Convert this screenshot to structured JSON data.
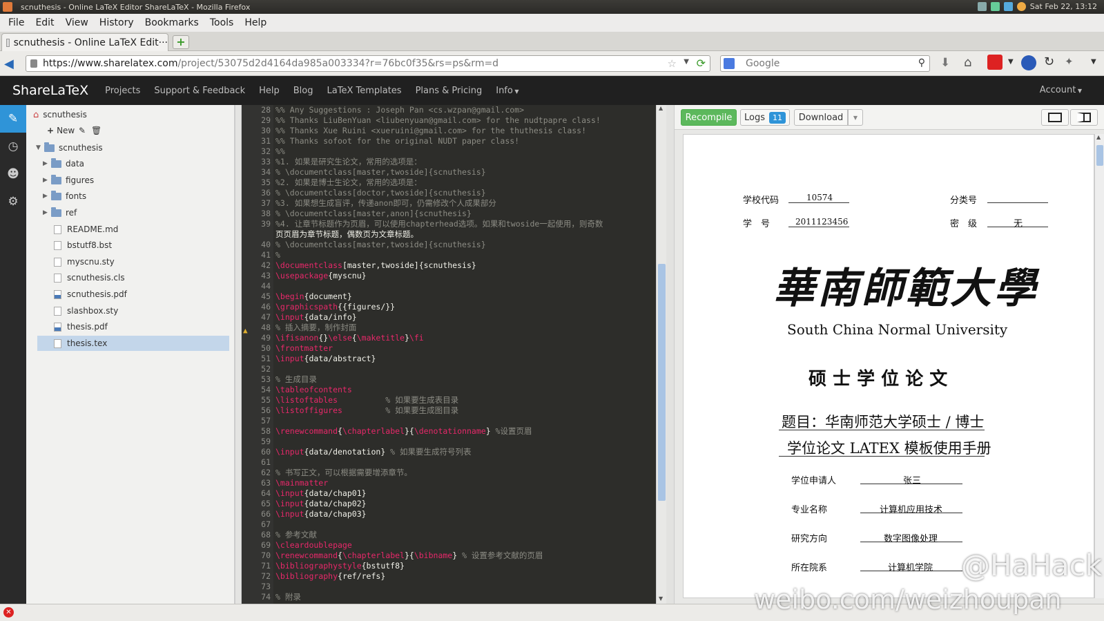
{
  "window": {
    "title": "scnuthesis - Online LaTeX Editor ShareLaTeX - Mozilla Firefox",
    "clock": "Sat Feb 22, 13:12"
  },
  "menubar": [
    "File",
    "Edit",
    "View",
    "History",
    "Bookmarks",
    "Tools",
    "Help"
  ],
  "tab": {
    "label": "scnuthesis - Online LaTeX Edit···"
  },
  "url": {
    "domain": "https://www.sharelatex.com",
    "path": "/project/53075d2d4164da985a003334?r=76bc0f35&rs=ps&rm=d"
  },
  "search": {
    "placeholder": "Google"
  },
  "app": {
    "logo": "ShareLaTeX",
    "nav": [
      "Projects",
      "Support & Feedback",
      "Help",
      "Blog",
      "LaTeX Templates",
      "Plans & Pricing",
      "Info"
    ],
    "account": "Account"
  },
  "filetree": {
    "root": "scnuthesis",
    "new_label": "New",
    "folder": "scnuthesis",
    "items": [
      {
        "name": "data",
        "type": "folder"
      },
      {
        "name": "figures",
        "type": "folder"
      },
      {
        "name": "fonts",
        "type": "folder"
      },
      {
        "name": "ref",
        "type": "folder"
      },
      {
        "name": "README.md",
        "type": "file"
      },
      {
        "name": "bstutf8.bst",
        "type": "file"
      },
      {
        "name": "myscnu.sty",
        "type": "file"
      },
      {
        "name": "scnuthesis.cls",
        "type": "file"
      },
      {
        "name": "scnuthesis.pdf",
        "type": "pdf"
      },
      {
        "name": "slashbox.sty",
        "type": "file"
      },
      {
        "name": "thesis.pdf",
        "type": "pdf"
      },
      {
        "name": "thesis.tex",
        "type": "file",
        "selected": true
      }
    ]
  },
  "editor": {
    "lines": [
      {
        "n": "28",
        "t": "%% Any Suggestions : Joseph Pan <cs.wzpan@gmail.com>"
      },
      {
        "n": "29",
        "t": "%% Thanks LiuBenYuan <liubenyuan@gmail.com> for the nudtpapre class!"
      },
      {
        "n": "30",
        "t": "%% Thanks Xue Ruini <xueruini@gmail.com> for the thuthesis class!"
      },
      {
        "n": "31",
        "t": "%% Thanks sofoot for the original NUDT paper class!"
      },
      {
        "n": "32",
        "t": "%%"
      },
      {
        "n": "33",
        "t": "%1. 如果是研究生论文，常用的选项是："
      },
      {
        "n": "34",
        "t": "% \\documentclass[master,twoside]{scnuthesis}"
      },
      {
        "n": "35",
        "t": "%2. 如果是博士生论文，常用的选项是："
      },
      {
        "n": "36",
        "t": "% \\documentclass[doctor,twoside]{scnuthesis}"
      },
      {
        "n": "37",
        "t": "%3. 如果想生成盲评，传递anon即可，仍需修改个人成果部分"
      },
      {
        "n": "38",
        "t": "% \\documentclass[master,anon]{scnuthesis}"
      },
      {
        "n": "39",
        "t": "%4. 让章节标题作为页眉，可以使用chapterhead选项。如果和twoside一起使用，则奇数"
      },
      {
        "n": "",
        "t": "页页眉为章节标题，偶数页为文章标题。"
      },
      {
        "n": "40",
        "t": "% \\documentclass[master,twoside]{scnuthesis}"
      },
      {
        "n": "41",
        "t": "%"
      },
      {
        "n": "42",
        "t": "\\documentclass[master,twoside]{scnuthesis}"
      },
      {
        "n": "43",
        "t": "\\usepackage{myscnu}"
      },
      {
        "n": "44",
        "t": ""
      },
      {
        "n": "45",
        "t": "\\begin{document}"
      },
      {
        "n": "46",
        "t": "\\graphicspath{{figures/}}"
      },
      {
        "n": "47",
        "t": "\\input{data/info}"
      },
      {
        "n": "48",
        "t": "% 插入摘要，制作封面"
      },
      {
        "n": "49",
        "t": "\\ifisanon{}\\else{\\maketitle}\\fi"
      },
      {
        "n": "50",
        "t": "\\frontmatter"
      },
      {
        "n": "51",
        "t": "\\input{data/abstract}"
      },
      {
        "n": "52",
        "t": ""
      },
      {
        "n": "53",
        "t": "% 生成目录"
      },
      {
        "n": "54",
        "t": "\\tableofcontents"
      },
      {
        "n": "55",
        "t": "\\listoftables          % 如果要生成表目录"
      },
      {
        "n": "56",
        "t": "\\listoffigures         % 如果要生成图目录"
      },
      {
        "n": "57",
        "t": ""
      },
      {
        "n": "58",
        "t": "\\renewcommand{\\chapterlabel}{\\denotationname} %设置页眉"
      },
      {
        "n": "59",
        "t": ""
      },
      {
        "n": "60",
        "t": "\\input{data/denotation} % 如果要生成符号列表"
      },
      {
        "n": "61",
        "t": ""
      },
      {
        "n": "62",
        "t": "% 书写正文，可以根据需要增添章节。"
      },
      {
        "n": "63",
        "t": "\\mainmatter"
      },
      {
        "n": "64",
        "t": "\\input{data/chap01}"
      },
      {
        "n": "65",
        "t": "\\input{data/chap02}"
      },
      {
        "n": "66",
        "t": "\\input{data/chap03}"
      },
      {
        "n": "67",
        "t": ""
      },
      {
        "n": "68",
        "t": "% 参考文献"
      },
      {
        "n": "69",
        "t": "\\cleardoublepage"
      },
      {
        "n": "70",
        "t": "\\renewcommand{\\chapterlabel}{\\bibname} % 设置参考文献的页眉"
      },
      {
        "n": "71",
        "t": "\\bibliographystyle{bstutf8}"
      },
      {
        "n": "72",
        "t": "\\bibliography{ref/refs}"
      },
      {
        "n": "73",
        "t": ""
      },
      {
        "n": "74",
        "t": "% 附录"
      }
    ]
  },
  "pdf_toolbar": {
    "recompile": "Recompile",
    "logs": "Logs",
    "logs_count": "11",
    "download": "Download"
  },
  "pdf": {
    "school_code_label": "学校代码",
    "school_code": "10574",
    "class_label": "分类号",
    "student_id_label": "学　号",
    "student_id": "2011123456",
    "secret_label": "密　级",
    "secret": "无",
    "university_cn": "華南師範大學",
    "university_en": "South China Normal University",
    "degree": "硕 士 学 位 论 文",
    "title1": "题目：华南师范大学硕士 / 博士",
    "title2": "学位论文 LATEX 模板使用手册",
    "fields": [
      {
        "label": "学位申请人",
        "value": "张三"
      },
      {
        "label": "专业名称",
        "value": "计算机应用技术"
      },
      {
        "label": "研究方向",
        "value": "数字图像处理"
      },
      {
        "label": "所在院系",
        "value": "计算机学院"
      }
    ]
  },
  "watermark": {
    "handle": "@HaHack",
    "site": "weibo.com/weizhoupan"
  }
}
